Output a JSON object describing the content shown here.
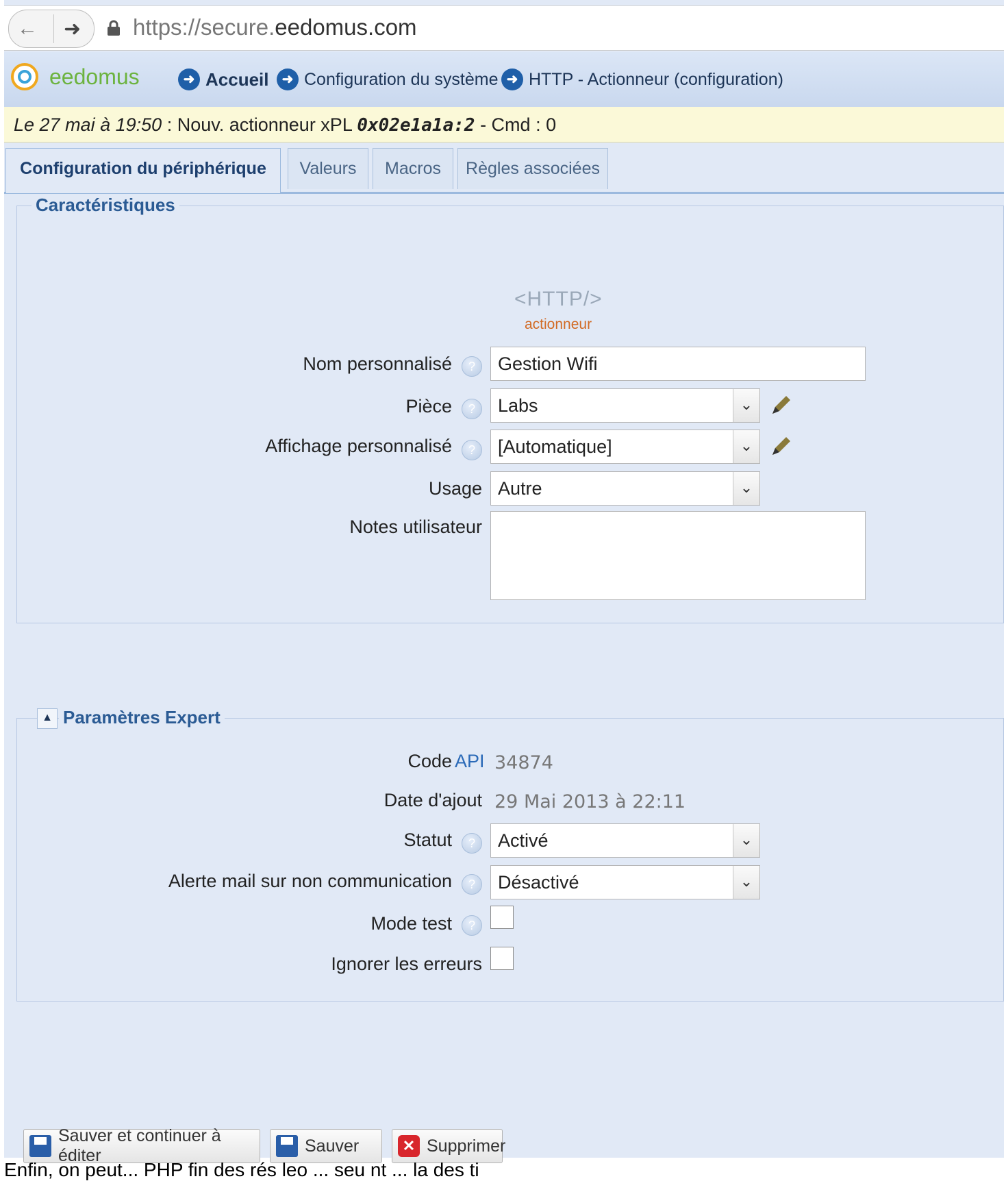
{
  "browser": {
    "url_prefix": "https://secure.",
    "url_domain": "eedomus.com"
  },
  "header": {
    "logo": "eedomus",
    "breadcrumbs": [
      {
        "label": "Accueil"
      },
      {
        "label": "Configuration du système"
      },
      {
        "label": "HTTP - Actionneur (configuration)"
      }
    ]
  },
  "notification": {
    "date": "Le 27 mai à 19:50",
    "message": ": Nouv. actionneur xPL",
    "code": "0x02e1a1a:2",
    "suffix": "- Cmd : 0"
  },
  "tabs": [
    {
      "label": "Configuration du périphérique",
      "active": true
    },
    {
      "label": "Valeurs"
    },
    {
      "label": "Macros"
    },
    {
      "label": "Règles associées"
    }
  ],
  "characteristics": {
    "legend": "Caractéristiques",
    "device_logo": "<HTTP/>",
    "device_type": "actionneur",
    "fields": {
      "name_label": "Nom personnalisé",
      "name_value": "Gestion Wifi",
      "room_label": "Pièce",
      "room_value": "Labs",
      "display_label": "Affichage personnalisé",
      "display_value": "[Automatique]",
      "usage_label": "Usage",
      "usage_value": "Autre",
      "notes_label": "Notes utilisateur",
      "notes_value": ""
    }
  },
  "expert": {
    "legend": "Paramètres Expert",
    "code_label": "Code",
    "code_api": "API",
    "code_value": "34874",
    "date_label": "Date d'ajout",
    "date_value": "29 Mai 2013 à 22:11",
    "status_label": "Statut",
    "status_value": "Activé",
    "alert_label": "Alerte mail sur non communication",
    "alert_value": "Désactivé",
    "test_label": "Mode test",
    "test_checked": false,
    "ignore_label": "Ignorer les erreurs",
    "ignore_checked": false
  },
  "buttons": {
    "save_continue": "Sauver et continuer à éditer",
    "save": "Sauver",
    "delete": "Supprimer"
  },
  "footer": {
    "caption": "Enfin, on peut...                                PHP   fin des rés   leo  ...   seu    nt  ...  la  des   ti"
  },
  "colors": {
    "accent": "#2b5b94",
    "page_bg": "#e1e9f6",
    "notification_bg": "#fbf9d8",
    "device_type": "#d26b25"
  }
}
